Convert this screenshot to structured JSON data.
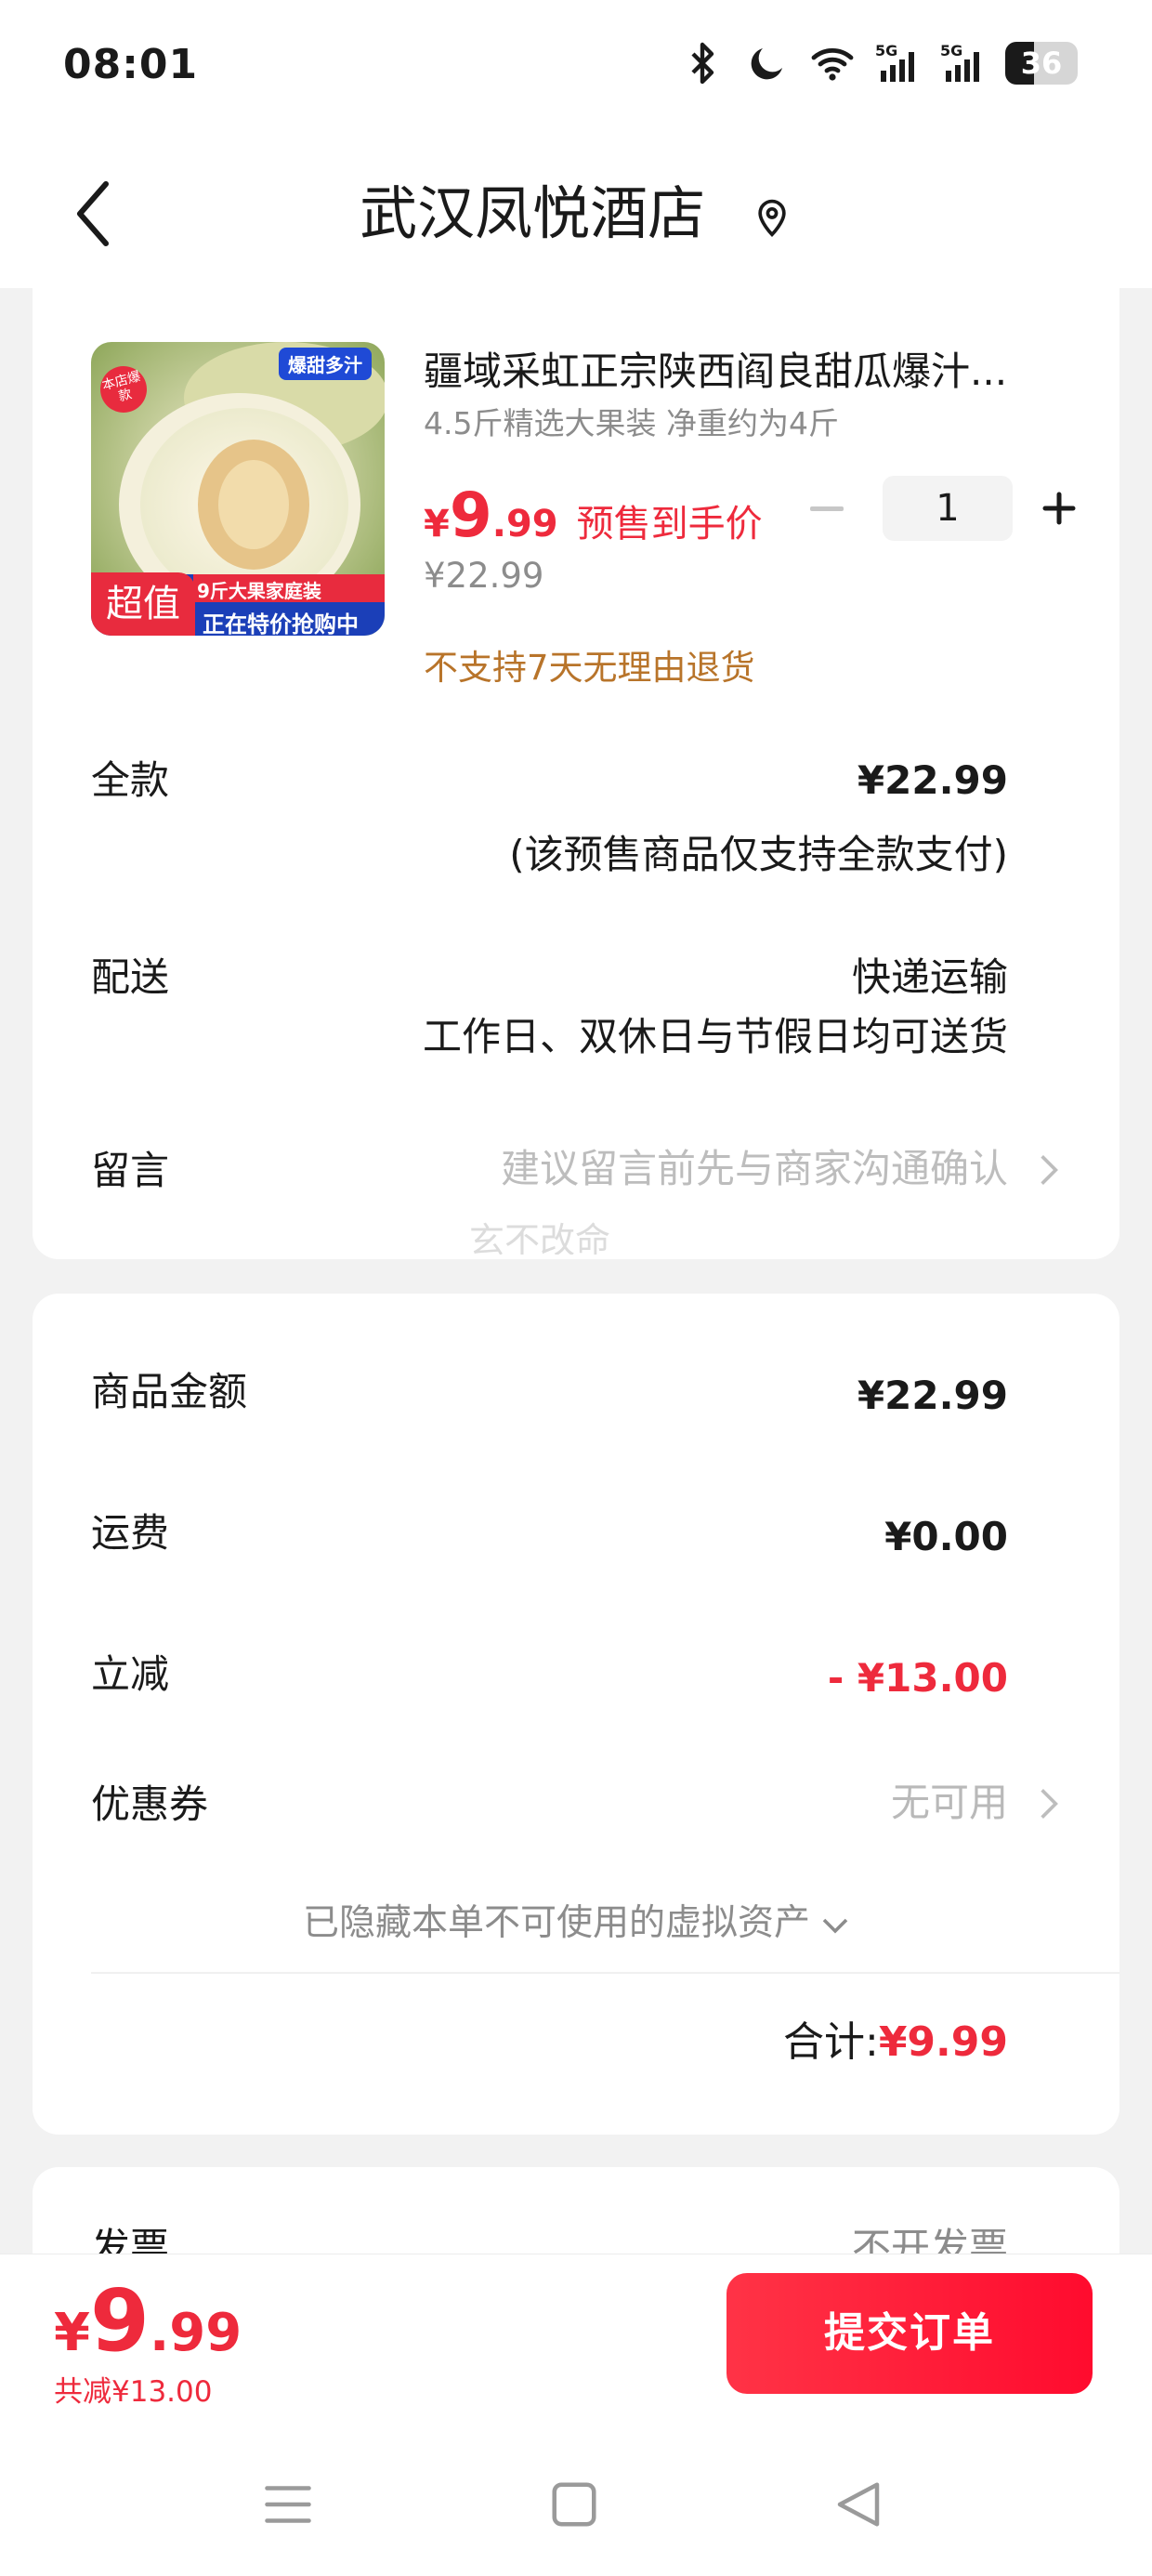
{
  "status_bar": {
    "time": "08:01",
    "icons": [
      "bluetooth-icon",
      "moon-icon",
      "wifi-icon",
      "5g-signal-icon",
      "5g-signal-icon",
      "battery-icon"
    ],
    "battery": "36"
  },
  "header": {
    "title": "武汉凤悦酒店",
    "back_icon": "back-arrow-icon",
    "location_icon": "location-pin-icon"
  },
  "product": {
    "title": "疆域采虹正宗陕西阎良甜瓜爆汁...",
    "spec": "4.5斤精选大果装 净重约为4斤",
    "price_symbol": "¥",
    "price_int": "9",
    "price_dec": ".99",
    "price_label": "预售到手价",
    "original_price": "¥22.99",
    "return_note": "不支持7天无理由退货",
    "quantity": "1",
    "image_texts": {
      "top_tag": "爆甜多汁",
      "corner_tag": "本店爆款",
      "badge": "超值",
      "banner_top": "9斤大果家庭装",
      "banner_bottom": "正在特价抢购中"
    },
    "colors": {
      "price": "#ee2a3c",
      "return_note": "#b8742a"
    }
  },
  "order": {
    "full_payment_label": "全款",
    "full_payment_value": "¥22.99",
    "full_payment_note": "(该预售商品仅支持全款支付)",
    "delivery_label": "配送",
    "delivery_value": "快递运输",
    "delivery_note": "工作日、双休日与节假日均可送货",
    "message_label": "留言",
    "message_placeholder": "建议留言前先与商家沟通确认",
    "message_overflow": "玄不改命"
  },
  "summary": {
    "goods_amount_label": "商品金额",
    "goods_amount": "¥22.99",
    "shipping_label": "运费",
    "shipping": "¥0.00",
    "discount_label": "立减",
    "discount": "- ¥13.00",
    "coupon_label": "优惠券",
    "coupon_value": "无可用",
    "hidden_assets": "已隐藏本单不可使用的虚拟资产",
    "total_label": "合计:",
    "total_value": "¥9.99"
  },
  "invoice": {
    "label": "发票",
    "value": "不开发票"
  },
  "bottom": {
    "price_symbol": "¥",
    "price_int": "9",
    "price_dec": ".99",
    "saved": "共减¥13.00",
    "submit_label": "提交订单",
    "accent": "#ff1a36"
  },
  "system_nav": [
    "menu-icon",
    "home-icon",
    "back-icon"
  ]
}
